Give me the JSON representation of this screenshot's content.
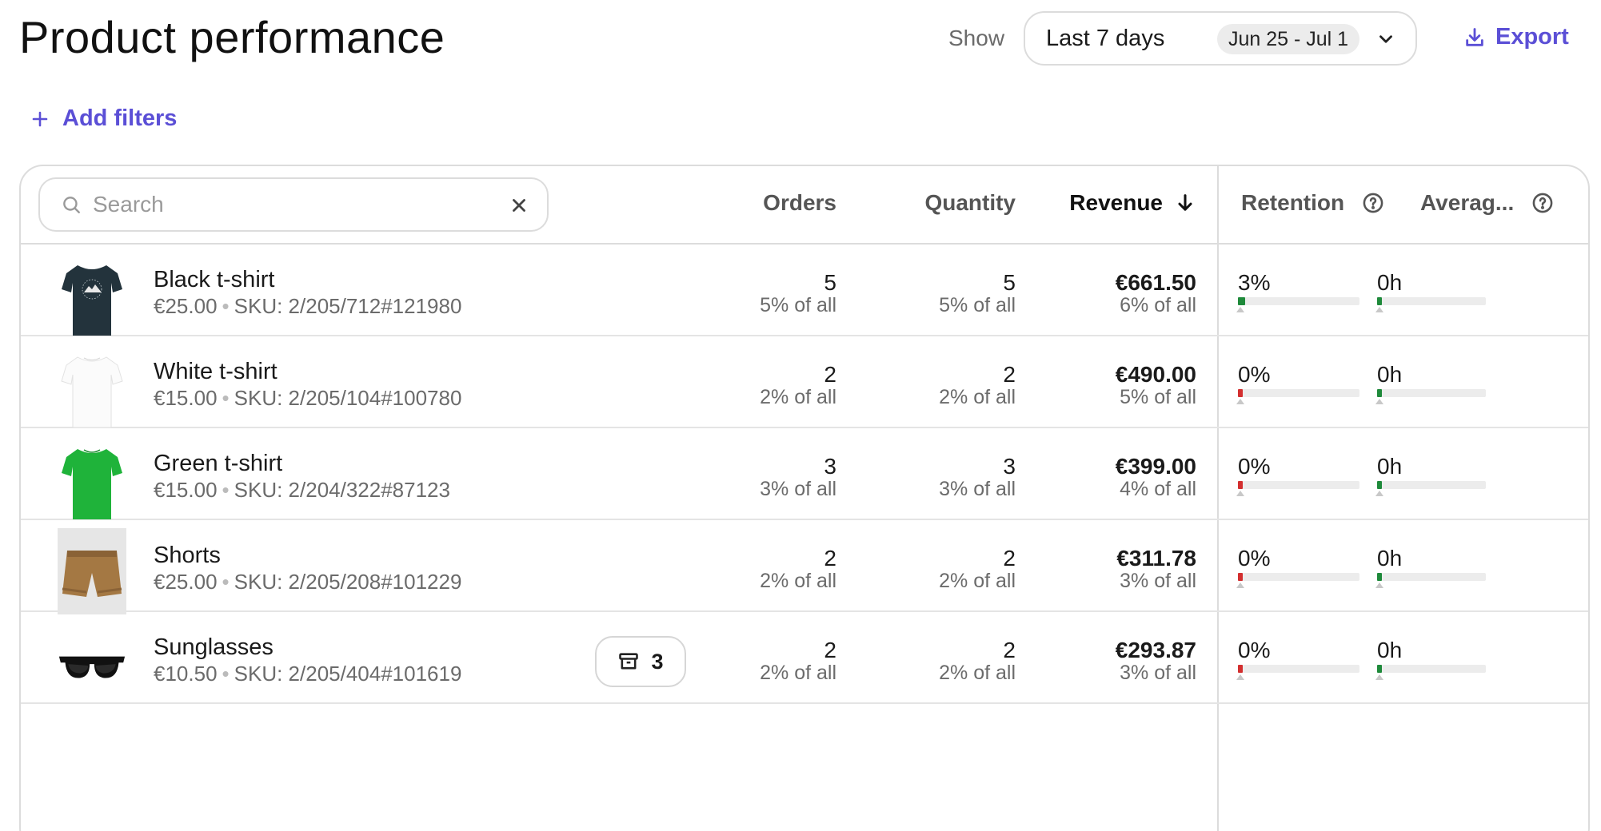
{
  "header": {
    "title": "Product performance",
    "show_label": "Show",
    "range_label": "Last 7 days",
    "range_dates": "Jun 25 - Jul 1",
    "export_label": "Export",
    "add_filters_label": "Add filters"
  },
  "table": {
    "search_placeholder": "Search",
    "columns": {
      "orders": "Orders",
      "quantity": "Quantity",
      "revenue": "Revenue",
      "retention": "Retention",
      "average": "Averag..."
    },
    "rows": [
      {
        "name": "Black t-shirt",
        "price": "€25.00",
        "sku": "SKU: 2/205/712#121980",
        "orders": "5",
        "orders_share": "5% of all",
        "quantity": "5",
        "quantity_share": "5% of all",
        "revenue": "€661.50",
        "revenue_share": "6% of all",
        "retention": "3%",
        "retention_value": 0.03,
        "retention_color": "#1f8a3b",
        "average": "0h",
        "average_value": 0,
        "average_color": "#1f8a3b",
        "thumb": "tshirt-black"
      },
      {
        "name": "White t-shirt",
        "price": "€15.00",
        "sku": "SKU: 2/205/104#100780",
        "orders": "2",
        "orders_share": "2% of all",
        "quantity": "2",
        "quantity_share": "2% of all",
        "revenue": "€490.00",
        "revenue_share": "5% of all",
        "retention": "0%",
        "retention_value": 0,
        "retention_color": "#d32f2f",
        "average": "0h",
        "average_value": 0,
        "average_color": "#1f8a3b",
        "thumb": "tshirt-white"
      },
      {
        "name": "Green t-shirt",
        "price": "€15.00",
        "sku": "SKU: 2/204/322#87123",
        "orders": "3",
        "orders_share": "3% of all",
        "quantity": "3",
        "quantity_share": "3% of all",
        "revenue": "€399.00",
        "revenue_share": "4% of all",
        "retention": "0%",
        "retention_value": 0,
        "retention_color": "#d32f2f",
        "average": "0h",
        "average_value": 0,
        "average_color": "#1f8a3b",
        "thumb": "tshirt-green"
      },
      {
        "name": "Shorts",
        "price": "€25.00",
        "sku": "SKU: 2/205/208#101229",
        "orders": "2",
        "orders_share": "2% of all",
        "quantity": "2",
        "quantity_share": "2% of all",
        "revenue": "€311.78",
        "revenue_share": "3% of all",
        "retention": "0%",
        "retention_value": 0,
        "retention_color": "#d32f2f",
        "average": "0h",
        "average_value": 0,
        "average_color": "#1f8a3b",
        "thumb": "shorts"
      },
      {
        "name": "Sunglasses",
        "price": "€10.50",
        "sku": "SKU: 2/205/404#101619",
        "orders": "2",
        "orders_share": "2% of all",
        "quantity": "2",
        "quantity_share": "2% of all",
        "revenue": "€293.87",
        "revenue_share": "3% of all",
        "retention": "0%",
        "retention_value": 0,
        "retention_color": "#d32f2f",
        "average": "0h",
        "average_value": 0,
        "average_color": "#1f8a3b",
        "thumb": "sunglasses",
        "archive_count": "3"
      }
    ]
  },
  "colors": {
    "accent": "#5b4fd6",
    "border": "#dcdcdc",
    "positive": "#1f8a3b",
    "negative": "#d32f2f"
  }
}
